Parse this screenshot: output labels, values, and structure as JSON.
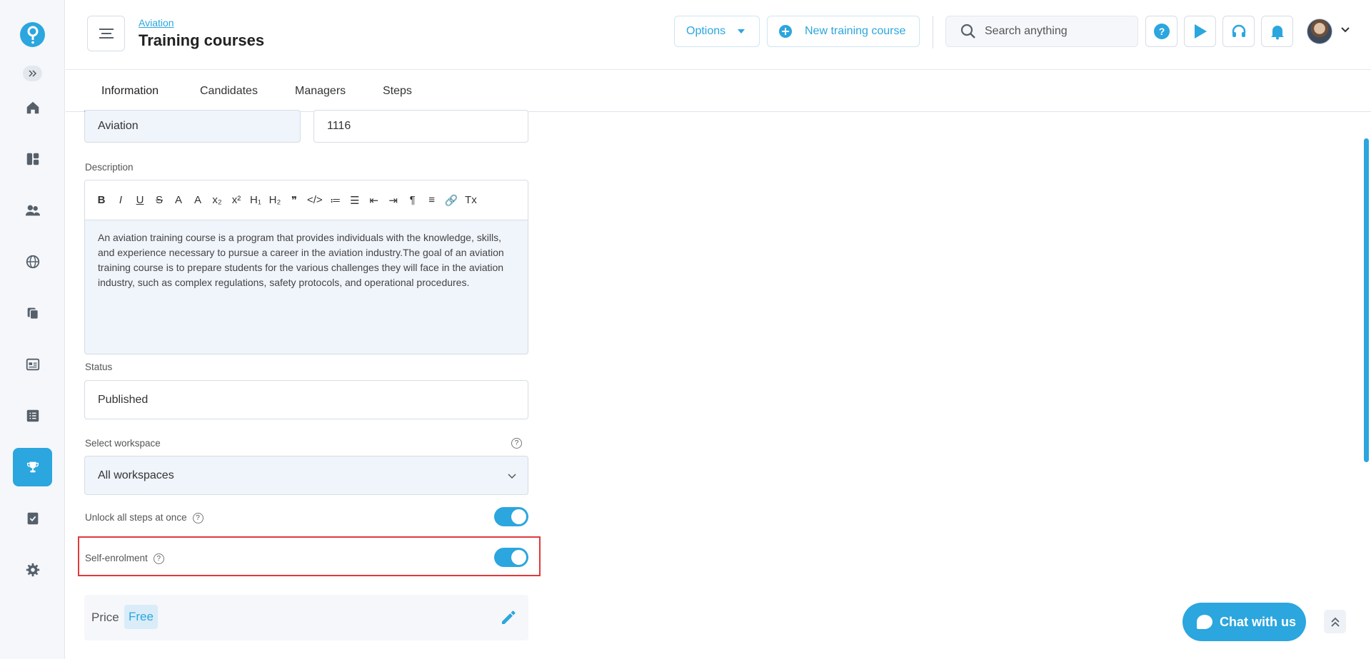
{
  "header": {
    "breadcrumb": "Aviation",
    "title": "Training courses",
    "options_label": "Options",
    "new_course_label": "New training course",
    "search_placeholder": "Search anything"
  },
  "tabs": [
    {
      "label": "Information",
      "active": true
    },
    {
      "label": "Candidates",
      "active": false
    },
    {
      "label": "Managers",
      "active": false
    },
    {
      "label": "Steps",
      "active": false
    }
  ],
  "form": {
    "category_value": "Aviation",
    "code_value": "1116",
    "description_label": "Description",
    "description_text": "An aviation training course is a program that provides individuals with the knowledge, skills, and experience necessary to pursue a career in the aviation industry.The goal of an aviation training course is to prepare students for the various challenges they will face in the aviation industry, such as complex regulations, safety protocols, and operational procedures.",
    "status_label": "Status",
    "status_value": "Published",
    "workspace_label": "Select workspace",
    "workspace_value": "All workspaces",
    "unlock_label": "Unlock all steps at once",
    "unlock_on": true,
    "self_enrolment_label": "Self-enrolment",
    "self_enrolment_on": true,
    "price_label": "Price",
    "price_value": "Free"
  },
  "toolbar": [
    "B",
    "I",
    "U",
    "S",
    "A",
    "A",
    "x₂",
    "x²",
    "H₁",
    "H₂",
    "❞",
    "</>",
    "≔",
    "☰",
    "⇤",
    "⇥",
    "¶",
    "≡",
    "🔗",
    "Tx"
  ],
  "chat": {
    "label": "Chat with us"
  },
  "colors": {
    "accent": "#2ba6de",
    "highlight": "#e03a3a"
  }
}
